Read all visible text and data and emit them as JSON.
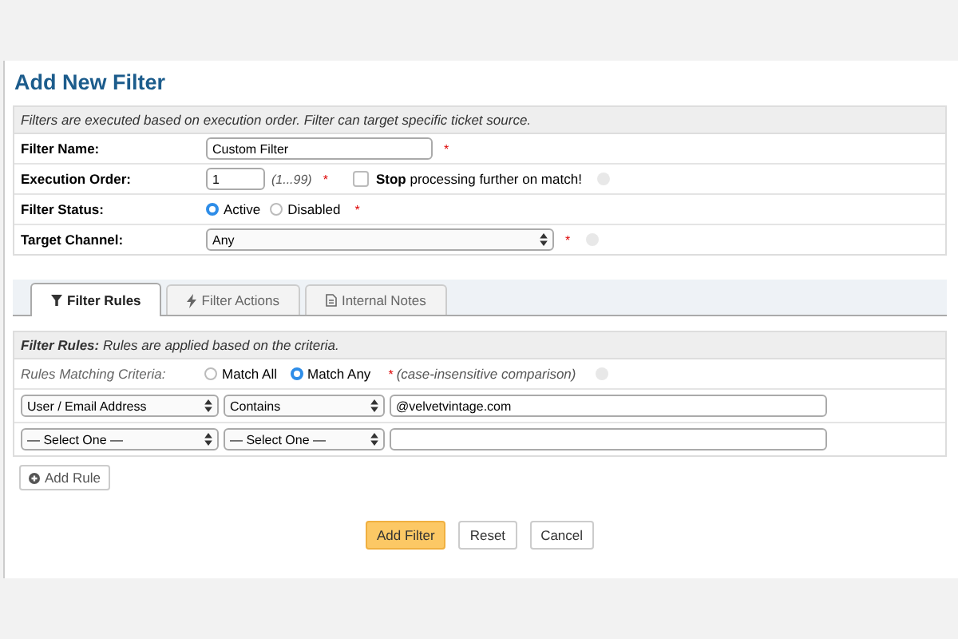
{
  "title": "Add New Filter",
  "info": "Filters are executed based on execution order. Filter can target specific ticket source.",
  "fields": [
    {
      "kind": "text",
      "label": "Filter Name:",
      "value": "Custom Filter",
      "required_mark": "*",
      "help": false
    },
    {
      "kind": "order",
      "label": "Execution Order:",
      "value": "1",
      "hint": "(1...99)",
      "required_mark": "*",
      "help": true,
      "checkbox": {
        "label": "**Stop** processing further on match!",
        "checked": false
      }
    },
    {
      "kind": "radio",
      "label": "Filter Status:",
      "options": [
        {
          "label": "Active",
          "selected": true
        },
        {
          "label": "Disabled",
          "selected": false
        }
      ],
      "required_mark": "*",
      "help": false
    },
    {
      "kind": "select",
      "label": "Target Channel:",
      "value": "Any",
      "required_mark": "*",
      "help": true
    }
  ],
  "tabs": [
    {
      "label": "Filter Rules",
      "kind": "rules",
      "selected": true
    },
    {
      "label": "Filter Actions",
      "kind": "actions",
      "selected": false
    },
    {
      "label": "Internal Notes",
      "kind": "notes",
      "selected": false
    }
  ],
  "rules": {
    "header": "**Filter Rules:** *Rules are applied based on the criteria.*",
    "criteria_label": "Rules Matching Criteria:",
    "criteria": [
      {
        "label": "Match All",
        "selected": false
      },
      {
        "label": "Match Any",
        "selected": true
      }
    ],
    "required_mark": "*",
    "hint": "(case-insensitive comparison)",
    "rows": [
      {
        "field": "User / Email Address",
        "operator": "Contains",
        "value": "@velvetvintage.com"
      },
      {
        "field": "— Select One —",
        "operator": "— Select One —"
      }
    ],
    "add_button": "Add Rule"
  },
  "buttons": [
    {
      "label": "Add Filter",
      "kind": "primary"
    },
    {
      "label": "Reset",
      "kind": "default"
    },
    {
      "label": "Cancel",
      "kind": "default"
    }
  ]
}
